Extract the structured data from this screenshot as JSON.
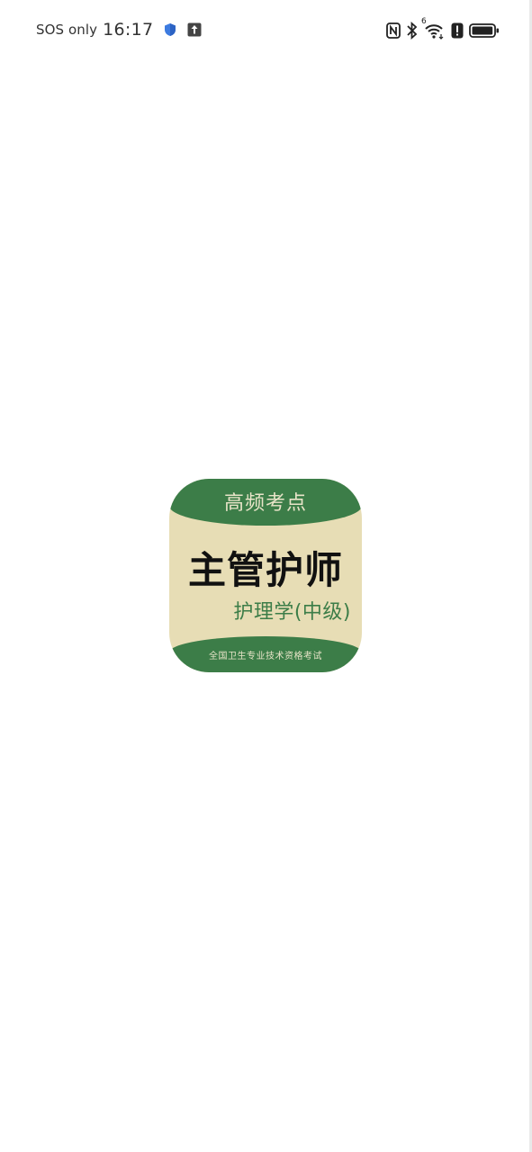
{
  "status_bar": {
    "carrier": "SOS only",
    "time": "16:17",
    "icons": [
      "shield-icon",
      "upload-icon",
      "nfc-icon",
      "bluetooth-icon",
      "wifi-icon",
      "alert-icon",
      "battery-icon"
    ],
    "wifi_badge": "6",
    "battery_level": 0.9
  },
  "splash": {
    "top_text": "高频考点",
    "title": "主管护师",
    "subtitle": "护理学(中级)",
    "bottom_text": "全国卫生专业技术资格考试"
  },
  "colors": {
    "accent_green": "#3c7d48",
    "icon_bg": "#e7ddb5",
    "shield_blue": "#3d7be0"
  }
}
